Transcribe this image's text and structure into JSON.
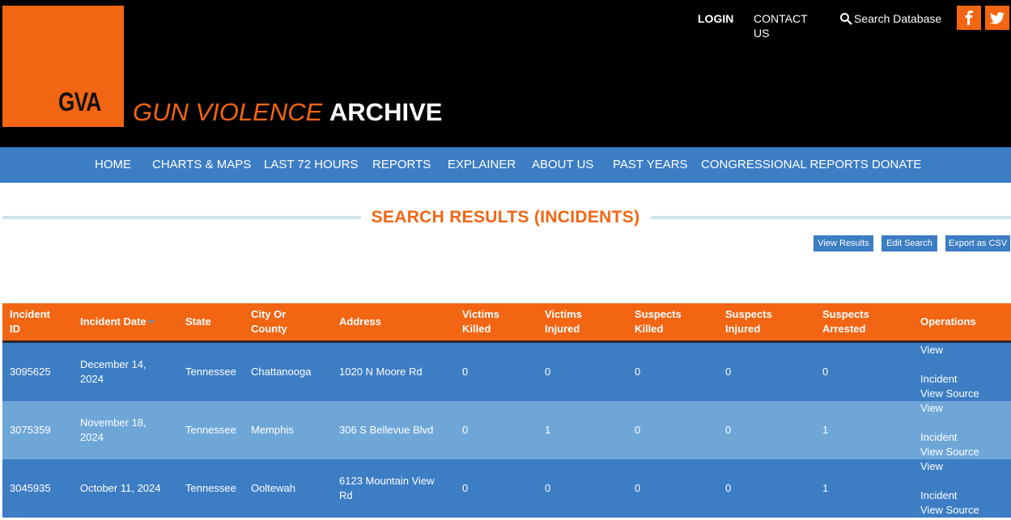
{
  "header": {
    "logo_text": "GVA",
    "site_title_part1": "GUN VIOLENCE",
    "site_title_part2": "ARCHIVE",
    "top_links": {
      "login": "LOGIN",
      "contact": "CONTACT US",
      "search": "Search Database"
    },
    "social": [
      "facebook-icon",
      "twitter-icon"
    ]
  },
  "mainnav": {
    "items": [
      "HOME",
      "CHARTS & MAPS",
      "LAST 72 HOURS",
      "REPORTS",
      "EXPLAINER",
      "ABOUT US",
      "PAST YEARS",
      "CONGRESSIONAL REPORTS",
      "DONATE"
    ]
  },
  "page": {
    "title": "SEARCH RESULTS (INCIDENTS)"
  },
  "actions": {
    "view_results": "View Results",
    "edit_search": "Edit Search",
    "export_csv": "Export as CSV"
  },
  "table": {
    "headers": {
      "incident_id_1": "Incident",
      "incident_id_2": "ID",
      "incident_date": "Incident Date",
      "state": "State",
      "city_1": "City Or",
      "city_2": "County",
      "address": "Address",
      "victims_killed_1": "Victims",
      "victims_killed_2": "Killed",
      "victims_injured_1": "Victims",
      "victims_injured_2": "Injured",
      "suspects_killed_1": "Suspects",
      "suspects_killed_2": "Killed",
      "suspects_injured_1": "Suspects",
      "suspects_injured_2": "Injured",
      "suspects_arrested_1": "Suspects",
      "suspects_arrested_2": "Arrested",
      "operations": "Operations"
    },
    "rows": [
      {
        "id": "3095625",
        "date_1": "December 14,",
        "date_2": "2024",
        "state": "Tennessee",
        "city": "Chattanooga",
        "address_1": "1020 N Moore Rd",
        "address_2": "",
        "victims_killed": "0",
        "victims_injured": "0",
        "suspects_killed": "0",
        "suspects_injured": "0",
        "suspects_arrested": "0",
        "op_view_1": "View",
        "op_view_2": "Incident",
        "op_source": "View Source"
      },
      {
        "id": "3075359",
        "date_1": "November 18,",
        "date_2": "2024",
        "state": "Tennessee",
        "city": "Memphis",
        "address_1": "306 S Bellevue Blvd",
        "address_2": "",
        "victims_killed": "0",
        "victims_injured": "1",
        "suspects_killed": "0",
        "suspects_injured": "0",
        "suspects_arrested": "1",
        "op_view_1": "View",
        "op_view_2": "Incident",
        "op_source": "View Source"
      },
      {
        "id": "3045935",
        "date_1": "October 11, 2024",
        "date_2": "",
        "state": "Tennessee",
        "city": "Ooltewah",
        "address_1": "6123 Mountain View",
        "address_2": "Rd",
        "victims_killed": "0",
        "victims_injured": "0",
        "suspects_killed": "0",
        "suspects_injured": "0",
        "suspects_arrested": "1",
        "op_view_1": "View",
        "op_view_2": "Incident",
        "op_source": "View Source"
      }
    ]
  },
  "colors": {
    "brand_orange": "#f26513",
    "nav_blue": "#3c7dc4",
    "row_light_blue": "#6ea6d8"
  }
}
